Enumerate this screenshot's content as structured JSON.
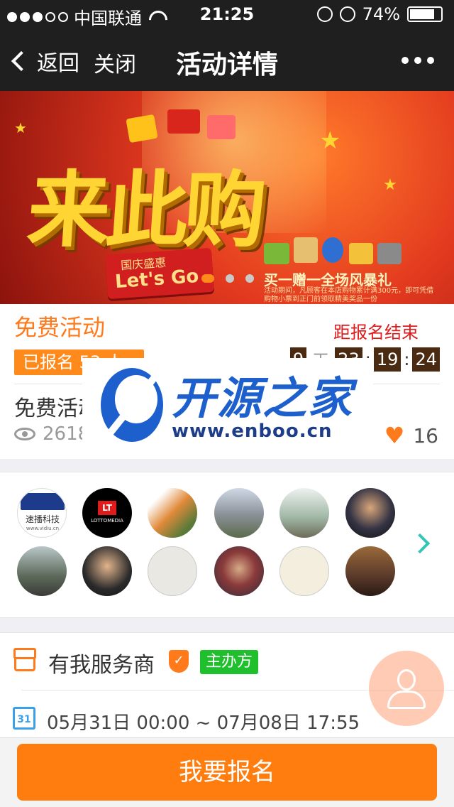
{
  "status_bar": {
    "carrier": "中国联通",
    "time": "21:25",
    "battery": "74%",
    "battery_level": 0.74,
    "signal_bars": 3
  },
  "nav": {
    "back_label": "返回",
    "close_label": "关闭",
    "title": "活动详情"
  },
  "banner": {
    "headline": "来此购",
    "ribbon_sub": "国庆盛惠",
    "ribbon_main": "Let's Go",
    "promo": "买一赠一全场风暴礼",
    "promo_small": "活动期间，凡顾客在本店购物累计满300元，即可凭借购物小票到正门前领取精美奖品一份",
    "slide_count": 3,
    "active_slide": 1
  },
  "event": {
    "type": "免费活动",
    "countdown_label": "距报名结束",
    "enrolled": "已报名 53 人",
    "countdown": {
      "days": "9",
      "day_unit": "天",
      "hours": "23",
      "minutes": "19",
      "seconds": "24"
    },
    "name": "免费活动",
    "views": "2618",
    "likes": "16"
  },
  "participants": [
    {
      "name": "速播科技",
      "sub": "www.vidiu.cn"
    },
    {
      "name": "LT",
      "sub": "LOTTOMEDIA"
    },
    {
      "name": ""
    },
    {
      "name": ""
    },
    {
      "name": ""
    },
    {
      "name": ""
    },
    {
      "name": ""
    },
    {
      "name": ""
    },
    {
      "name": ""
    },
    {
      "name": ""
    },
    {
      "name": ""
    },
    {
      "name": ""
    }
  ],
  "organizer": {
    "name": "有我服务商",
    "badge": "主办方",
    "calendar_day": "31",
    "date_range": "05月31日 00:00 ~ 07月08日 17:55"
  },
  "actions": {
    "signup": "我要报名"
  },
  "watermark": {
    "title": "开源之家",
    "url": "www.enboo.cn"
  },
  "colors": {
    "accent": "#ff7d0f",
    "nav": "#1f1f1f",
    "host_badge": "#1fbf2d",
    "countdown_text": "#e01b1b"
  }
}
